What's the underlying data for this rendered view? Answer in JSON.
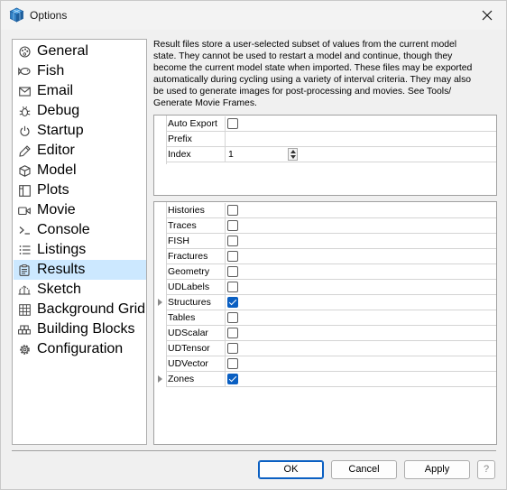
{
  "window": {
    "title": "Options",
    "close_icon": "close-icon",
    "app_icon": "app-cube-icon"
  },
  "nav": {
    "items": [
      {
        "label": "General",
        "icon": "palette-icon"
      },
      {
        "label": "Fish",
        "icon": "fish-icon"
      },
      {
        "label": "Email",
        "icon": "envelope-icon"
      },
      {
        "label": "Debug",
        "icon": "bug-icon"
      },
      {
        "label": "Startup",
        "icon": "power-icon"
      },
      {
        "label": "Editor",
        "icon": "pencil-icon"
      },
      {
        "label": "Model",
        "icon": "cube-icon"
      },
      {
        "label": "Plots",
        "icon": "plot-window-icon"
      },
      {
        "label": "Movie",
        "icon": "movie-camera-icon"
      },
      {
        "label": "Console",
        "icon": "console-prompt-icon"
      },
      {
        "label": "Listings",
        "icon": "list-icon"
      },
      {
        "label": "Results",
        "icon": "clipboard-icon"
      },
      {
        "label": "Sketch",
        "icon": "sketch-icon"
      },
      {
        "label": "Background Grid",
        "icon": "grid-icon"
      },
      {
        "label": "Building Blocks",
        "icon": "blocks-icon"
      },
      {
        "label": "Configuration",
        "icon": "gear-icon"
      }
    ],
    "selected": "Results"
  },
  "description": {
    "lines": [
      "Result files store a user-selected subset of values from the current model",
      "state. They cannot be used to restart a model and continue, though they",
      "become the current model state when imported. These files may be exported",
      "automatically during cycling using a variety of interval criteria. They may also",
      "be used to generate images for post-processing and movies. See Tools/",
      "Generate Movie Frames."
    ]
  },
  "export_settings": {
    "auto_export": {
      "label": "Auto Export",
      "checked": false
    },
    "prefix": {
      "label": "Prefix",
      "value": ""
    },
    "index": {
      "label": "Index",
      "value": "1"
    }
  },
  "result_items": [
    {
      "label": "Histories",
      "checked": false,
      "expandable": false
    },
    {
      "label": "Traces",
      "checked": false,
      "expandable": false
    },
    {
      "label": "FISH",
      "checked": false,
      "expandable": false
    },
    {
      "label": "Fractures",
      "checked": false,
      "expandable": false
    },
    {
      "label": "Geometry",
      "checked": false,
      "expandable": false
    },
    {
      "label": "UDLabels",
      "checked": false,
      "expandable": false
    },
    {
      "label": "Structures",
      "checked": true,
      "expandable": true
    },
    {
      "label": "Tables",
      "checked": false,
      "expandable": false
    },
    {
      "label": "UDScalar",
      "checked": false,
      "expandable": false
    },
    {
      "label": "UDTensor",
      "checked": false,
      "expandable": false
    },
    {
      "label": "UDVector",
      "checked": false,
      "expandable": false
    },
    {
      "label": "Zones",
      "checked": true,
      "expandable": true
    }
  ],
  "buttons": {
    "ok": "OK",
    "cancel": "Cancel",
    "apply": "Apply",
    "help": "?"
  },
  "colors": {
    "selection": "#cce8ff",
    "accent": "#0a5fc2",
    "background": "#f0f0f0"
  }
}
